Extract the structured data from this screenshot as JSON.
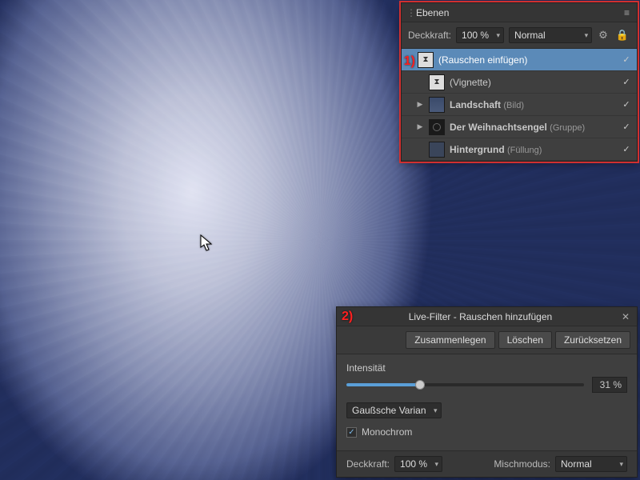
{
  "layers_panel": {
    "title": "Ebenen",
    "opacity_label": "Deckkraft:",
    "opacity_value": "100 %",
    "blend_mode": "Normal",
    "layers": [
      {
        "name": "(Rauschen einfügen)",
        "type": "",
        "selected": true,
        "thumb": "hourglass",
        "expandable": false,
        "visible": true
      },
      {
        "name": "(Vignette)",
        "type": "",
        "selected": false,
        "thumb": "hourglass",
        "expandable": false,
        "visible": true
      },
      {
        "name": "Landschaft",
        "type": "(Bild)",
        "selected": false,
        "thumb": "landscape",
        "expandable": true,
        "visible": true
      },
      {
        "name": "Der Weihnachtsengel",
        "type": "(Gruppe)",
        "selected": false,
        "thumb": "circle-dark",
        "expandable": true,
        "visible": true
      },
      {
        "name": "Hintergrund",
        "type": "(Füllung)",
        "selected": false,
        "thumb": "fill",
        "expandable": false,
        "visible": true
      }
    ]
  },
  "filter_panel": {
    "title": "Live-Filter - Rauschen hinzufügen",
    "buttons": {
      "merge": "Zusammenlegen",
      "delete": "Löschen",
      "reset": "Zurücksetzen"
    },
    "intensity_label": "Intensität",
    "intensity_value": "31 %",
    "intensity_pct": 31,
    "variance_dropdown": "Gaußsche Varian",
    "monochrome_label": "Monochrom",
    "monochrome_checked": true,
    "opacity_label": "Deckkraft:",
    "opacity_value": "100 %",
    "blend_label": "Mischmodus:",
    "blend_value": "Normal"
  },
  "markers": {
    "one": "1)",
    "two": "2)"
  }
}
